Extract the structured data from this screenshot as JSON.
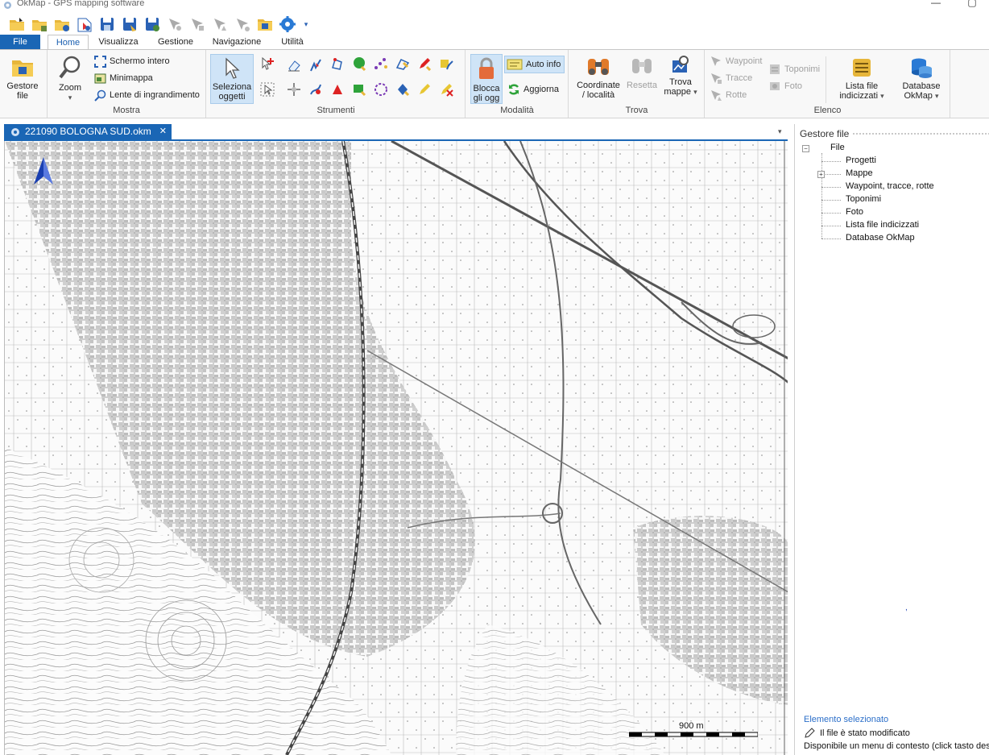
{
  "window": {
    "title": "OkMap - GPS mapping software",
    "minimize": "—",
    "maximize": "▢"
  },
  "quick_access": {
    "dropdown": "▾"
  },
  "tabs": [
    {
      "label": "File"
    },
    {
      "label": "Home"
    },
    {
      "label": "Visualizza"
    },
    {
      "label": "Gestione"
    },
    {
      "label": "Navigazione"
    },
    {
      "label": "Utilità"
    }
  ],
  "ribbon": {
    "gestore_file": {
      "line1": "Gestore",
      "line2": "file"
    },
    "mostra": {
      "label": "Mostra",
      "zoom": "Zoom",
      "zoom_drop": "▾",
      "schermo_intero": "Schermo intero",
      "minimappa": "Minimappa",
      "lente": "Lente di ingrandimento"
    },
    "strumenti": {
      "label": "Strumenti",
      "seleziona_line1": "Seleziona",
      "seleziona_line2": "oggetti"
    },
    "modalita": {
      "label": "Modalità",
      "blocca_line1": "Blocca",
      "blocca_line2": "gli ogg",
      "auto_info": "Auto info",
      "aggiorna": "Aggiorna"
    },
    "trova": {
      "label": "Trova",
      "coordinate_line1": "Coordinate",
      "coordinate_line2": "/ località",
      "resetta": "Resetta",
      "trova_line1": "Trova",
      "trova_line2": "mappe",
      "trova_drop": "▾"
    },
    "elenco": {
      "label": "Elenco",
      "waypoint": "Waypoint",
      "tracce": "Tracce",
      "rotte": "Rotte",
      "toponimi": "Toponimi",
      "foto": "Foto",
      "lista_line1": "Lista file",
      "lista_line2": "indicizzati",
      "lista_drop": "▾",
      "database_line1": "Database",
      "database_line2": "OkMap",
      "database_drop": "▾"
    }
  },
  "document": {
    "tab_title": "221090 BOLOGNA SUD.okm",
    "close": "✕",
    "dropdown": "▾"
  },
  "map": {
    "scale_label": "900 m"
  },
  "side_panel": {
    "title": "Gestore file",
    "root": "File",
    "root_expander": "−",
    "mappe_expander": "+",
    "items": [
      "Progetti",
      "Mappe",
      "Waypoint, tracce, rotte",
      "Toponimi",
      "Foto",
      "Lista file indicizzati",
      "Database OkMap"
    ],
    "selected_title": "Elemento selezionato",
    "selected_status": "Il file è stato modificato",
    "context_hint": "Disponibile un menu di contesto (click tasto destro)"
  },
  "colors": {
    "accent": "#1a66b5",
    "selected_bg": "#cfe4f7",
    "link_blue": "#2c6fc9"
  }
}
